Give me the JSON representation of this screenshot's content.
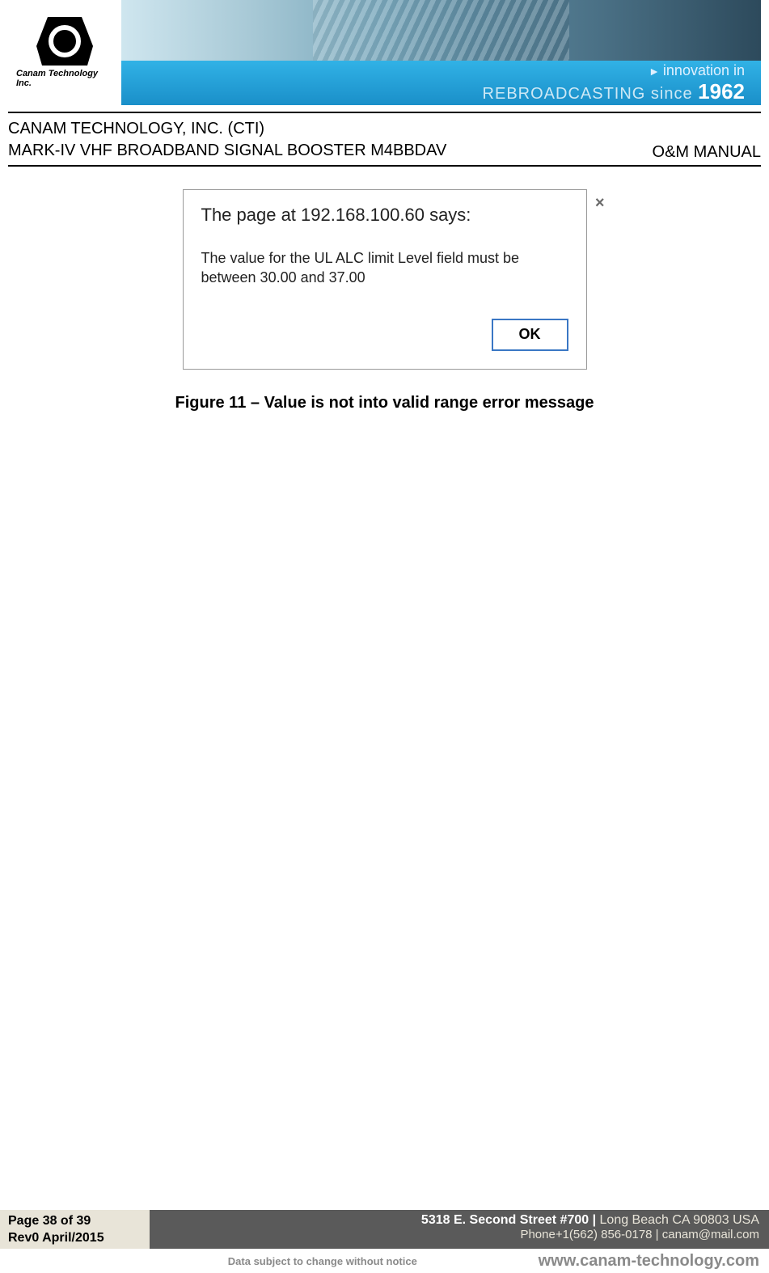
{
  "banner": {
    "logo_text": "Canam Technology Inc.",
    "tag_innovation": "innovation in",
    "tag_rebroadcast_prefix": "REBROADCASTING since ",
    "tag_year": "1962"
  },
  "meta": {
    "company": "CANAM TECHNOLOGY, INC. (CTI)",
    "product": "MARK-IV VHF BROADBAND SIGNAL BOOSTER M4BBDAV",
    "doc_type": "O&M MANUAL"
  },
  "dialog": {
    "title": "The page at 192.168.100.60 says:",
    "message": "The value for the UL ALC limit Level field must be between 30.00 and 37.00",
    "ok_label": "OK",
    "close_glyph": "×"
  },
  "caption": "Figure 11 – Value is not into valid range error message",
  "footer": {
    "page": "Page 38 of 39",
    "rev": "Rev0 April/2015",
    "address_bold": "5318 E. Second Street  #700 | ",
    "address_rest": "Long Beach CA 90803 USA",
    "phone": "Phone+1(562) 856-0178 | canam@mail.com",
    "notice": "Data subject to change without notice",
    "url": "www.canam-technology.com"
  }
}
